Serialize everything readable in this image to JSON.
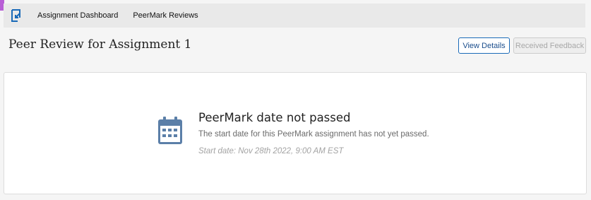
{
  "nav": {
    "logo_icon": "turnitin-logo-icon",
    "links": [
      "Assignment Dashboard",
      "PeerMark Reviews"
    ]
  },
  "header": {
    "title": "Peer Review for Assignment 1",
    "view_details_label": "View Details",
    "received_feedback_label": "Received Feedback"
  },
  "message": {
    "icon": "calendar-icon",
    "heading": "PeerMark date not passed",
    "body": "The start date for this PeerMark assignment has not yet passed.",
    "start_date": "Start date: Nov 28th 2022, 9:00 AM EST"
  },
  "colors": {
    "accent": "#b85fd6",
    "primary": "#1a6ab8",
    "icon": "#5b7fa8"
  }
}
